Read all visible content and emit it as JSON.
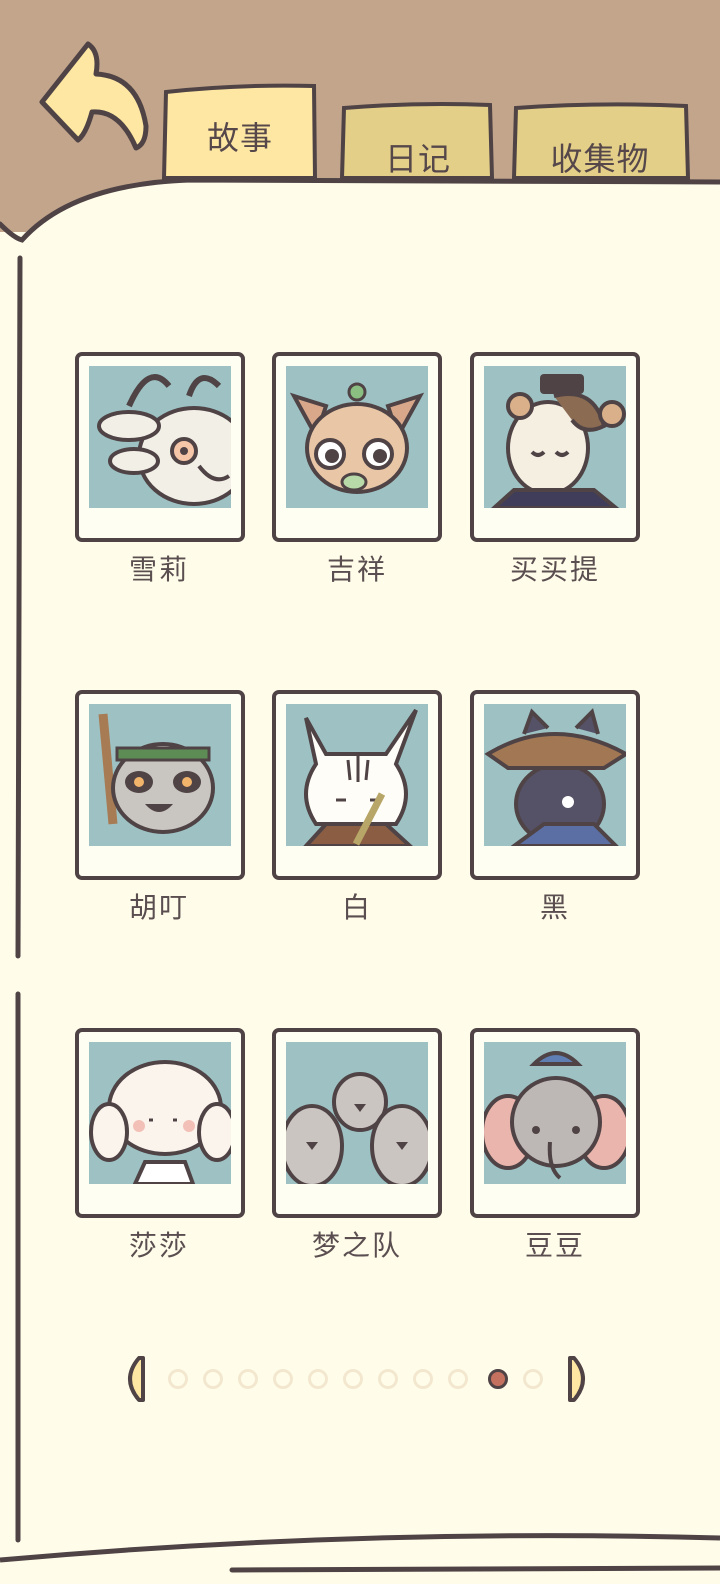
{
  "tabs": [
    {
      "label": "故事",
      "active": true
    },
    {
      "label": "日记",
      "active": false
    },
    {
      "label": "收集物",
      "active": false
    }
  ],
  "characters": [
    {
      "name": "雪莉",
      "icon": "rabbit-icon"
    },
    {
      "name": "吉祥",
      "icon": "chihuahua-icon"
    },
    {
      "name": "买买提",
      "icon": "camel-icon"
    },
    {
      "name": "胡叮",
      "icon": "raccoon-icon"
    },
    {
      "name": "白",
      "icon": "white-fox-icon"
    },
    {
      "name": "黑",
      "icon": "black-cat-icon"
    },
    {
      "name": "莎莎",
      "icon": "sheep-icon"
    },
    {
      "name": "梦之队",
      "icon": "penguins-icon"
    },
    {
      "name": "豆豆",
      "icon": "elephant-icon"
    }
  ],
  "pagination": {
    "total_pages": 11,
    "current_page": 10
  },
  "colors": {
    "background_brown": "#c2a58a",
    "paper": "#fffde9",
    "outline": "#4f4346",
    "tab_active": "#fde7a3",
    "tab_inactive": "#e3cf88",
    "photo_bg": "#9ec2c3",
    "dot_active": "#c4715f"
  }
}
